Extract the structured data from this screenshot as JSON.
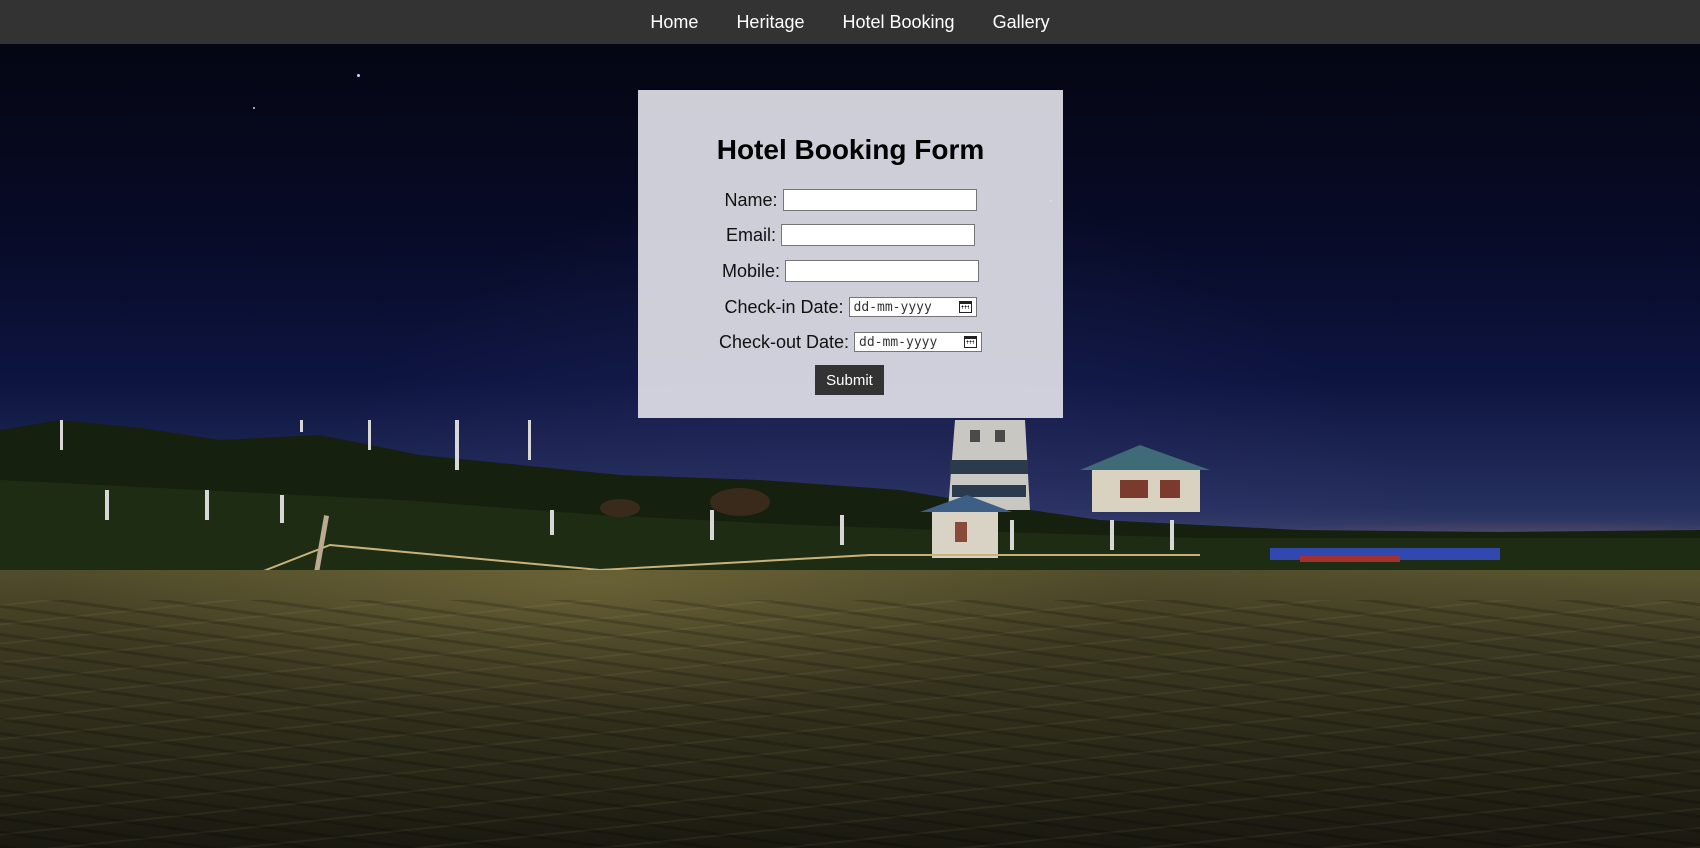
{
  "nav": {
    "items": [
      {
        "label": "Home"
      },
      {
        "label": "Heritage"
      },
      {
        "label": "Hotel Booking"
      },
      {
        "label": "Gallery"
      }
    ]
  },
  "form": {
    "title": "Hotel Booking Form",
    "name_label": "Name:",
    "email_label": "Email:",
    "mobile_label": "Mobile:",
    "checkin_label": "Check-in Date:",
    "checkin_placeholder": "dd-mm-yyyy",
    "checkout_label": "Check-out Date:",
    "checkout_placeholder": "dd-mm-yyyy",
    "name_value": "",
    "email_value": "",
    "mobile_value": "",
    "submit_label": "Submit"
  },
  "colors": {
    "navbar": "#333333",
    "card": "#dedee6",
    "button": "#333333"
  },
  "icons": {
    "date_picker": "calendar-icon"
  }
}
